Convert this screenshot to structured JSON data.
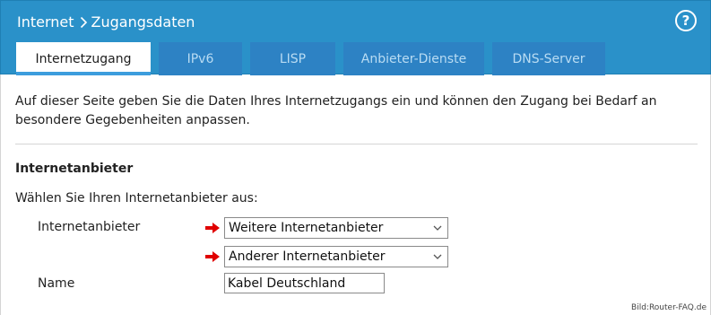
{
  "header": {
    "breadcrumb_root": "Internet",
    "breadcrumb_current": "Zugangsdaten",
    "help_label": "?"
  },
  "tabs": [
    {
      "label": "Internetzugang",
      "active": true
    },
    {
      "label": "IPv6",
      "active": false
    },
    {
      "label": "LISP",
      "active": false
    },
    {
      "label": "Anbieter-Dienste",
      "active": false
    },
    {
      "label": "DNS-Server",
      "active": false
    }
  ],
  "main": {
    "intro": "Auf dieser Seite geben Sie die Daten Ihres Internetzugangs ein und können den Zugang bei Bedarf an besondere Gegebenheiten anpassen.",
    "section_title": "Internetanbieter",
    "choose_label": "Wählen Sie Ihren Internetanbieter aus:",
    "provider_label": "Internetanbieter",
    "provider_select_value": "Weitere Internetanbieter",
    "provider_sub_select_value": "Anderer Internetanbieter",
    "name_label": "Name",
    "name_value": "Kabel Deutschland"
  },
  "watermark": "Bild:Router-FAQ.de",
  "colors": {
    "header_bg": "#2a91c9",
    "tab_bg": "#2d82c4",
    "tab_active_underline": "#3c9ddd",
    "arrow": "#e00000"
  }
}
